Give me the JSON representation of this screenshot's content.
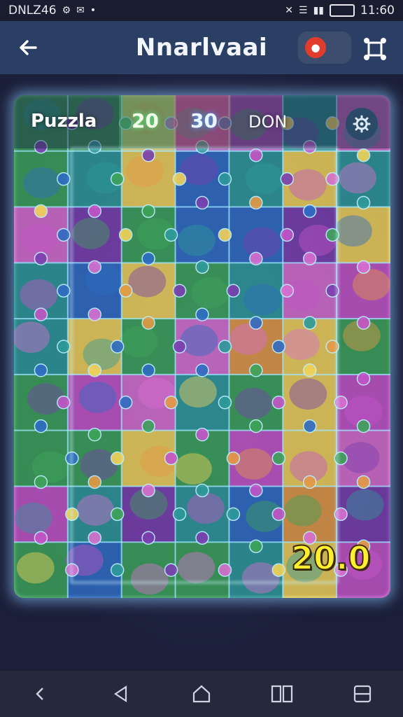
{
  "status_bar": {
    "carrier": "DNLZ46",
    "time": "11:60",
    "battery": ""
  },
  "app_bar": {
    "title": "Nnarlvaai"
  },
  "hud": {
    "label": "Puzzla",
    "value_a": "20",
    "value_b": "30",
    "mode": "DON"
  },
  "score": "20.0",
  "colors": {
    "pink": "#d86fd0",
    "magenta": "#c455c8",
    "yellow": "#f2d35a",
    "teal": "#2e9a9a",
    "blue": "#2f6cc4",
    "green": "#3da35a",
    "orange": "#e49a45",
    "purple": "#7b3fb0"
  },
  "icons": {
    "back": "arrow-left-icon",
    "settings": "gear-icon",
    "fullscreen": "fullscreen-icon",
    "record": "record-icon"
  }
}
